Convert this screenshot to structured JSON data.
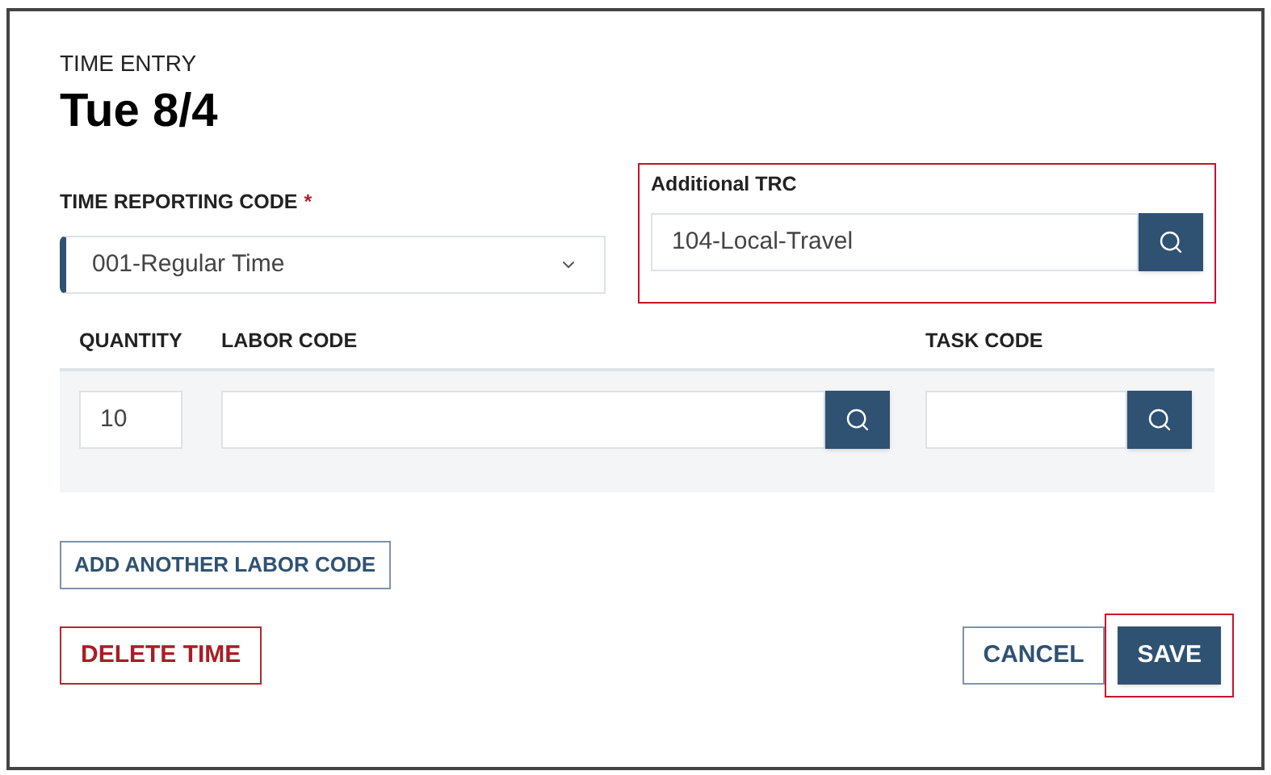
{
  "header": {
    "eyebrow": "TIME ENTRY",
    "title": "Tue 8/4"
  },
  "trc": {
    "label": "TIME REPORTING CODE",
    "required_mark": "*",
    "value": "001-Regular Time"
  },
  "additional_trc": {
    "label": "Additional TRC",
    "value": "104-Local-Travel",
    "highlighted": true
  },
  "labor": {
    "columns": [
      "QUANTITY",
      "LABOR CODE",
      "TASK CODE"
    ],
    "rows": [
      {
        "quantity": "10",
        "labor_code": "",
        "task_code": ""
      }
    ]
  },
  "add_button": "ADD ANOTHER LABOR CODE",
  "buttons": [
    {
      "label": "DELETE TIME",
      "kind": "danger",
      "highlighted": false
    },
    {
      "label": "CANCEL",
      "kind": "secondary",
      "highlighted": false
    },
    {
      "label": "SAVE",
      "kind": "primary",
      "highlighted": true
    }
  ]
}
